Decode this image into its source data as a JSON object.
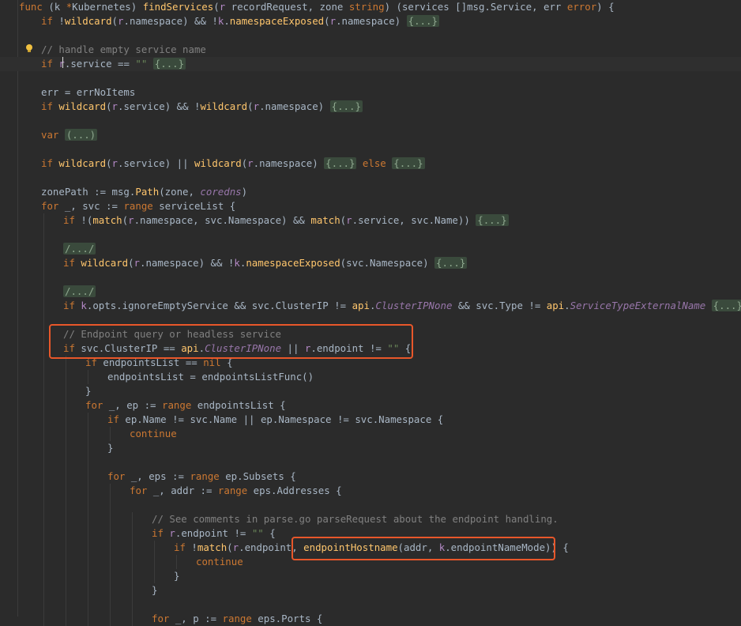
{
  "editor": {
    "lines": [
      {
        "indent": 0,
        "tokens": [
          [
            "kw",
            "func "
          ],
          [
            "id",
            "(k "
          ],
          [
            "kw",
            "*"
          ],
          [
            "ty",
            "Kubernetes"
          ],
          [
            "id",
            ") "
          ],
          [
            "fn",
            "findServices"
          ],
          [
            "id",
            "("
          ],
          [
            "pm",
            "r"
          ],
          [
            "id",
            " recordRequest, zone "
          ],
          [
            "kw",
            "string"
          ],
          [
            "id",
            ") (services []msg."
          ],
          [
            "ty",
            "Service"
          ],
          [
            "id",
            ", err "
          ],
          [
            "kw",
            "error"
          ],
          [
            "id",
            ") {"
          ]
        ]
      },
      {
        "indent": 1,
        "tokens": [
          [
            "kw",
            "if "
          ],
          [
            "id",
            "!"
          ],
          [
            "fn",
            "wildcard"
          ],
          [
            "id",
            "("
          ],
          [
            "pm",
            "r"
          ],
          [
            "id",
            ".namespace) && !"
          ],
          [
            "pm",
            "k"
          ],
          [
            "id",
            "."
          ],
          [
            "fn",
            "namespaceExposed"
          ],
          [
            "id",
            "("
          ],
          [
            "pm",
            "r"
          ],
          [
            "id",
            ".namespace) "
          ],
          [
            "fold",
            "{...}"
          ]
        ]
      },
      {
        "indent": 1,
        "tokens": []
      },
      {
        "indent": 1,
        "tokens": [
          [
            "cm",
            "// handle empty service name"
          ]
        ]
      },
      {
        "indent": 1,
        "tokens": [
          [
            "kw",
            "if "
          ],
          [
            "pm",
            "r"
          ],
          [
            "id",
            ".service == "
          ],
          [
            "st",
            "\"\""
          ],
          [
            "id",
            " "
          ],
          [
            "fold",
            "{...}"
          ]
        ]
      },
      {
        "indent": 1,
        "tokens": []
      },
      {
        "indent": 1,
        "tokens": [
          [
            "id",
            "err = errNoItems"
          ]
        ]
      },
      {
        "indent": 1,
        "tokens": [
          [
            "kw",
            "if "
          ],
          [
            "fn",
            "wildcard"
          ],
          [
            "id",
            "("
          ],
          [
            "pm",
            "r"
          ],
          [
            "id",
            ".service) && !"
          ],
          [
            "fn",
            "wildcard"
          ],
          [
            "id",
            "("
          ],
          [
            "pm",
            "r"
          ],
          [
            "id",
            ".namespace) "
          ],
          [
            "fold",
            "{...}"
          ]
        ]
      },
      {
        "indent": 1,
        "tokens": []
      },
      {
        "indent": 1,
        "tokens": [
          [
            "kw",
            "var "
          ],
          [
            "fold",
            "(...)"
          ]
        ]
      },
      {
        "indent": 1,
        "tokens": []
      },
      {
        "indent": 1,
        "tokens": [
          [
            "kw",
            "if "
          ],
          [
            "fn",
            "wildcard"
          ],
          [
            "id",
            "("
          ],
          [
            "pm",
            "r"
          ],
          [
            "id",
            ".service) || "
          ],
          [
            "fn",
            "wildcard"
          ],
          [
            "id",
            "("
          ],
          [
            "pm",
            "r"
          ],
          [
            "id",
            ".namespace) "
          ],
          [
            "fold",
            "{...}"
          ],
          [
            "kw",
            " else "
          ],
          [
            "fold",
            "{...}"
          ]
        ]
      },
      {
        "indent": 1,
        "tokens": []
      },
      {
        "indent": 1,
        "tokens": [
          [
            "id",
            "zonePath := msg."
          ],
          [
            "fn",
            "Path"
          ],
          [
            "id",
            "(zone, "
          ],
          [
            "it",
            "coredns"
          ],
          [
            "id",
            ")"
          ]
        ]
      },
      {
        "indent": 1,
        "tokens": [
          [
            "kw",
            "for "
          ],
          [
            "id",
            "_, svc := "
          ],
          [
            "kw",
            "range "
          ],
          [
            "id",
            "serviceList {"
          ]
        ]
      },
      {
        "indent": 2,
        "tokens": [
          [
            "kw",
            "if "
          ],
          [
            "id",
            "!("
          ],
          [
            "fn",
            "match"
          ],
          [
            "id",
            "("
          ],
          [
            "pm",
            "r"
          ],
          [
            "id",
            ".namespace, svc.Namespace) && "
          ],
          [
            "fn",
            "match"
          ],
          [
            "id",
            "("
          ],
          [
            "pm",
            "r"
          ],
          [
            "id",
            ".service, svc.Name)) "
          ],
          [
            "fold",
            "{...}"
          ]
        ]
      },
      {
        "indent": 2,
        "tokens": []
      },
      {
        "indent": 2,
        "tokens": [
          [
            "fold",
            "/.../"
          ]
        ]
      },
      {
        "indent": 2,
        "tokens": [
          [
            "kw",
            "if "
          ],
          [
            "fn",
            "wildcard"
          ],
          [
            "id",
            "("
          ],
          [
            "pm",
            "r"
          ],
          [
            "id",
            ".namespace) && !"
          ],
          [
            "pm",
            "k"
          ],
          [
            "id",
            "."
          ],
          [
            "fn",
            "namespaceExposed"
          ],
          [
            "id",
            "(svc.Namespace) "
          ],
          [
            "fold",
            "{...}"
          ]
        ]
      },
      {
        "indent": 2,
        "tokens": []
      },
      {
        "indent": 2,
        "tokens": [
          [
            "fold",
            "/.../"
          ]
        ]
      },
      {
        "indent": 2,
        "tokens": [
          [
            "kw",
            "if "
          ],
          [
            "pm",
            "k"
          ],
          [
            "id",
            ".opts.ignoreEmptyService && svc.ClusterIP != "
          ],
          [
            "fn",
            "api"
          ],
          [
            "id",
            "."
          ],
          [
            "it",
            "ClusterIPNone"
          ],
          [
            "id",
            " && svc.Type != "
          ],
          [
            "fn",
            "api"
          ],
          [
            "id",
            "."
          ],
          [
            "it",
            "ServiceTypeExternalName"
          ],
          [
            "id",
            " "
          ],
          [
            "fold",
            "{...}"
          ]
        ]
      },
      {
        "indent": 2,
        "tokens": []
      },
      {
        "indent": 2,
        "tokens": [
          [
            "cm",
            "// Endpoint query or headless service"
          ]
        ]
      },
      {
        "indent": 2,
        "tokens": [
          [
            "kw",
            "if "
          ],
          [
            "id",
            "svc.ClusterIP == "
          ],
          [
            "fn",
            "api"
          ],
          [
            "id",
            "."
          ],
          [
            "it",
            "ClusterIPNone"
          ],
          [
            "id",
            " || "
          ],
          [
            "pm",
            "r"
          ],
          [
            "id",
            ".endpoint != "
          ],
          [
            "st",
            "\"\""
          ],
          [
            "id",
            " {"
          ]
        ]
      },
      {
        "indent": 3,
        "tokens": [
          [
            "kw",
            "if "
          ],
          [
            "id",
            "endpointsList == "
          ],
          [
            "kw",
            "nil"
          ],
          [
            "id",
            " {"
          ]
        ]
      },
      {
        "indent": 4,
        "tokens": [
          [
            "id",
            "endpointsList = endpointsListFunc()"
          ]
        ]
      },
      {
        "indent": 3,
        "tokens": [
          [
            "id",
            "}"
          ]
        ]
      },
      {
        "indent": 3,
        "tokens": [
          [
            "kw",
            "for "
          ],
          [
            "id",
            "_, ep := "
          ],
          [
            "kw",
            "range "
          ],
          [
            "id",
            "endpointsList {"
          ]
        ]
      },
      {
        "indent": 4,
        "tokens": [
          [
            "kw",
            "if "
          ],
          [
            "id",
            "ep.Name != svc.Name || ep.Namespace != svc.Namespace {"
          ]
        ]
      },
      {
        "indent": 5,
        "tokens": [
          [
            "kw",
            "continue"
          ]
        ]
      },
      {
        "indent": 4,
        "tokens": [
          [
            "id",
            "}"
          ]
        ]
      },
      {
        "indent": 4,
        "tokens": []
      },
      {
        "indent": 4,
        "tokens": [
          [
            "kw",
            "for "
          ],
          [
            "id",
            "_, eps := "
          ],
          [
            "kw",
            "range "
          ],
          [
            "id",
            "ep.Subsets {"
          ]
        ]
      },
      {
        "indent": 5,
        "tokens": [
          [
            "kw",
            "for "
          ],
          [
            "id",
            "_, addr := "
          ],
          [
            "kw",
            "range "
          ],
          [
            "id",
            "eps.Addresses {"
          ]
        ]
      },
      {
        "indent": 5,
        "tokens": []
      },
      {
        "indent": 6,
        "tokens": [
          [
            "cm",
            "// See comments in parse.go parseRequest about the endpoint handling."
          ]
        ]
      },
      {
        "indent": 6,
        "tokens": [
          [
            "kw",
            "if "
          ],
          [
            "pm",
            "r"
          ],
          [
            "id",
            ".endpoint != "
          ],
          [
            "st",
            "\"\""
          ],
          [
            "id",
            " {"
          ]
        ]
      },
      {
        "indent": 7,
        "tokens": [
          [
            "kw",
            "if "
          ],
          [
            "id",
            "!"
          ],
          [
            "fn",
            "match"
          ],
          [
            "id",
            "("
          ],
          [
            "pm",
            "r"
          ],
          [
            "id",
            ".endpoint, "
          ],
          [
            "fn",
            "endpointHostname"
          ],
          [
            "id",
            "(addr, "
          ],
          [
            "pm",
            "k"
          ],
          [
            "id",
            ".endpointNameMode)) {"
          ]
        ]
      },
      {
        "indent": 8,
        "tokens": [
          [
            "kw",
            "continue"
          ]
        ]
      },
      {
        "indent": 7,
        "tokens": [
          [
            "id",
            "}"
          ]
        ]
      },
      {
        "indent": 6,
        "tokens": [
          [
            "id",
            "}"
          ]
        ]
      },
      {
        "indent": 6,
        "tokens": []
      },
      {
        "indent": 6,
        "tokens": [
          [
            "kw",
            "for "
          ],
          [
            "id",
            "_, p := "
          ],
          [
            "kw",
            "range "
          ],
          [
            "id",
            "eps.Ports {"
          ]
        ]
      }
    ]
  },
  "colors": {
    "background": "#2b2b2b",
    "highlight": "#e8572a",
    "keyword": "#cc7832",
    "function": "#ffc66d",
    "comment": "#808080",
    "string": "#6a8759",
    "param": "#b389c5"
  },
  "icons": {
    "intention": "lightbulb-icon"
  }
}
